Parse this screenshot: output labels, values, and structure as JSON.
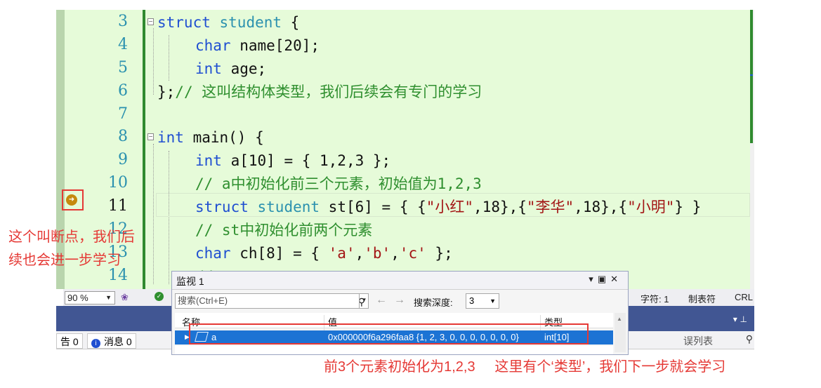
{
  "editor": {
    "line_numbers": [
      "3",
      "4",
      "5",
      "6",
      "7",
      "8",
      "9",
      "10",
      "11",
      "12",
      "13",
      "14"
    ],
    "code": {
      "l3_kw": "struct",
      "l3_ty": "student",
      "l3_rest": " {",
      "l4_kw": "char",
      "l4_rest": " name[20];",
      "l5_kw": "int",
      "l5_rest": " age;",
      "l6_text": "};",
      "l6_comment": "// 这叫结构体类型，我们后续会有专门的学习",
      "l8_kw": "int",
      "l8_rest": " main() {",
      "l9_kw": "int",
      "l9_rest": " a[10] = { 1,2,3 };",
      "l10_comment": "// a中初始化前三个元素，初始值为1,2,3",
      "l11_kw": "struct",
      "l11_ty": "student",
      "l11_a": " st[6] = { {",
      "l11_s1": "\"小红\"",
      "l11_b": ",18},{",
      "l11_s2": "\"李华\"",
      "l11_c": ",18},{",
      "l11_s3": "\"小明\"",
      "l11_d": "} }",
      "l12_comment": "// st中初始化前两个元素",
      "l13_kw": "char",
      "l13_a": " ch[8] = { ",
      "l13_s1": "'a'",
      "l13_b": ",",
      "l13_s2": "'b'",
      "l13_c": ",",
      "l13_s3": "'c'",
      "l13_d": " };",
      "l14_comment": "//"
    }
  },
  "status_bar": {
    "zoom": "90 %",
    "char_label": "字符: 1",
    "tab_label": "制表符",
    "eol_label": "CRL"
  },
  "bottom_tabs": {
    "warnings": "告 0",
    "messages": "消息 0",
    "error_list": "误列表"
  },
  "watch": {
    "title": "监视 1",
    "search_placeholder": "搜索(Ctrl+E)",
    "depth_label": "搜索深度:",
    "depth_value": "3",
    "col_name": "名称",
    "col_value": "值",
    "col_type": "类型",
    "row": {
      "name": "a",
      "value": "0x000000f6a296faa8 {1, 2, 3, 0, 0, 0, 0, 0, 0, 0}",
      "type": "int[10]"
    }
  },
  "annotations": {
    "breakpoint_note_1": "这个叫断点，我们后",
    "breakpoint_note_2": "续也会进一步学习",
    "bottom_note": "前3个元素初始化为1,2,3     这里有个‘类型’，我们下一步就会学习"
  }
}
